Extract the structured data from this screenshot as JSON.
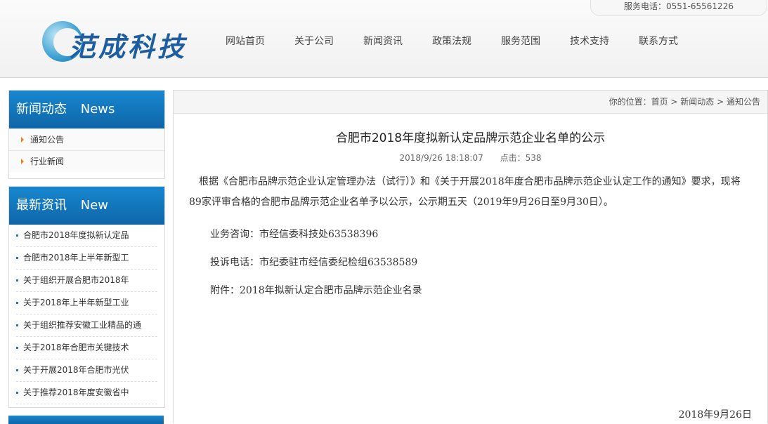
{
  "header": {
    "phone": "服务电话：0551-65561226",
    "logo_text": "范成科技",
    "nav": [
      "网站首页",
      "关于公司",
      "新闻资讯",
      "政策法规",
      "服务范围",
      "技术支持",
      "联系方式"
    ]
  },
  "sidebar": {
    "news_box": {
      "title": "新闻动态",
      "title_en": "News",
      "items": [
        "通知公告",
        "行业新闻"
      ]
    },
    "latest_box": {
      "title": "最新资讯",
      "title_en": "New",
      "items": [
        "合肥市2018年度拟新认定品",
        "合肥市2018年上半年新型工",
        "关于组织开展合肥市2018年",
        "关于2018年上半年新型工业",
        "关于组织推荐安徽工业精品的通",
        "关于2018年合肥市关键技术",
        "关于开展2018年合肥市光伏",
        "关于推荐2018年度安徽省中"
      ]
    }
  },
  "breadcrumb": {
    "prefix": "你的位置：",
    "items": [
      "首页",
      "新闻动态",
      "通知公告"
    ],
    "sep": " > "
  },
  "article": {
    "title": "合肥市2018年度拟新认定品牌示范企业名单的公示",
    "datetime": "2018/9/26 18:18:07",
    "clicks": "点击：538",
    "p1": "根据《合肥市品牌示范企业认定管理办法（试行）》和《关于开展2018年度合肥市品牌示范企业认定工作的通知》要求，现将89家评审合格的合肥市品牌示范企业名单予以公示，公示期五天（2019年9月26日至9月30日）。",
    "consult": "业务咨询：市经信委科技处63538396",
    "complaint": "投诉电话：市纪委驻市经信委纪检组63538589",
    "attachment": "附件：2018年拟新认定合肥市品牌示范企业名录",
    "date": "2018年9月26日"
  }
}
